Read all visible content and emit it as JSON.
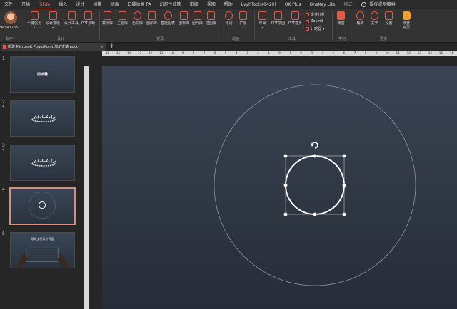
{
  "menu": {
    "tabs": [
      "文件",
      "开始",
      "iSlide",
      "插入",
      "设计",
      "切换",
      "动画",
      "口袋动画 PA",
      "幻灯片放映",
      "审阅",
      "视图",
      "帮助",
      "LvyhTools(0429)",
      "OK Plus",
      "OneKey Lite",
      "格式"
    ],
    "active_index": 2,
    "tell_me": "操作说明搜索"
  },
  "ribbon": {
    "account": {
      "name": "94941765...",
      "group": "账户"
    },
    "design_group": {
      "label": "设计",
      "buttons": [
        "一键优化",
        "设计排版",
        "设计工具",
        "PPT诊断"
      ]
    },
    "resource_group": {
      "label": "资源",
      "buttons": [
        "案例库",
        "主题库",
        "色彩库",
        "图示库",
        "智能图表",
        "图标库",
        "图片库",
        "插图库"
      ]
    },
    "animation_group": {
      "label": "动画",
      "buttons": [
        "补间",
        "扩展"
      ]
    },
    "tools_group": {
      "label": "工具",
      "buttons": [
        "导出",
        "PPT拼图",
        "PPT瘦身"
      ],
      "mini": [
        "文件分析",
        "ZoomIt",
        "计时器"
      ]
    },
    "learn_group": {
      "label": "学习",
      "buttons": [
        "课堂"
      ]
    },
    "more_group": {
      "label": "更多",
      "buttons": [
        "帮助",
        "关于",
        "设置",
        "续费会员"
      ]
    }
  },
  "document_tab": {
    "title": "新建 Microsoft PowerPoint 演示文稿.pptx",
    "close": "×",
    "new": "+"
  },
  "ruler_ticks": [
    "16",
    "15",
    "14",
    "13",
    "12",
    "11",
    "10",
    "9",
    "8",
    "7",
    "6",
    "5",
    "4",
    "3",
    "2",
    "1",
    "0",
    "1",
    "2",
    "3",
    "4",
    "5",
    "6",
    "7",
    "8",
    "9",
    "10",
    "11",
    "12",
    "13",
    "14",
    "15",
    "16"
  ],
  "slides": [
    {
      "number": "1",
      "title": "阅读量",
      "star": ""
    },
    {
      "number": "2",
      "title": "",
      "star": "*"
    },
    {
      "number": "3",
      "title": "",
      "star": "*"
    },
    {
      "number": "4",
      "title": "",
      "star": "",
      "selected": true
    },
    {
      "number": "5",
      "title": "眼睛支持双持界面",
      "star": ""
    }
  ],
  "colors": {
    "accent": "#e05a48",
    "canvas_top": "#3a4453",
    "canvas_bottom": "#262d38"
  }
}
